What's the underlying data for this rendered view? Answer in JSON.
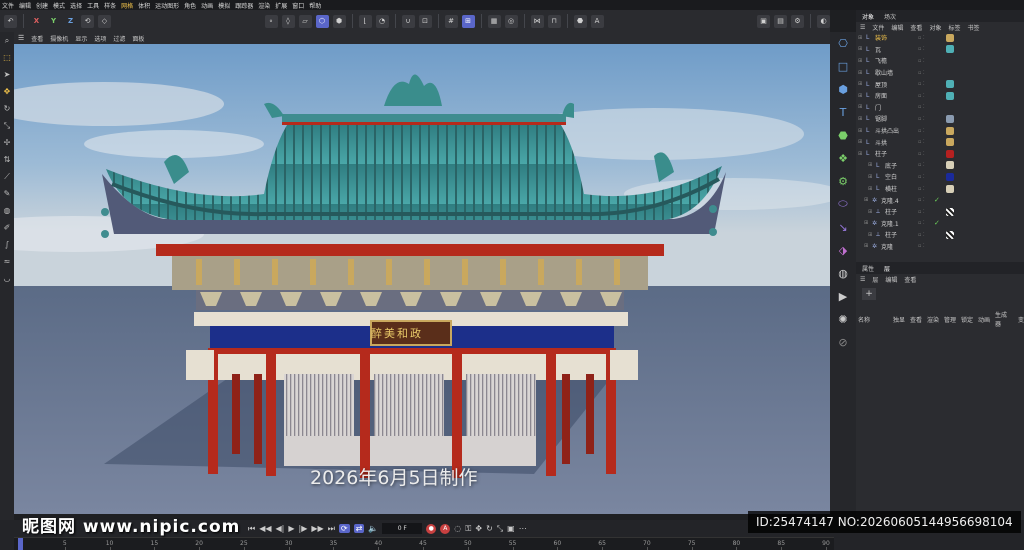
{
  "menubar": {
    "items": [
      "文件",
      "编辑",
      "创建",
      "模式",
      "选择",
      "工具",
      "样条",
      "网格",
      "体积",
      "运动图形",
      "角色",
      "动画",
      "模拟",
      "跟踪器",
      "渲染",
      "扩展",
      "窗口",
      "帮助"
    ]
  },
  "toolbar": {
    "x": "X",
    "y": "Y",
    "z": "Z"
  },
  "viewport_menu": [
    "查看",
    "摄像机",
    "显示",
    "选项",
    "过滤",
    "面板"
  ],
  "object_manager": {
    "tabs": [
      "对象",
      "场次"
    ],
    "menu": [
      "文件",
      "编辑",
      "查看",
      "对象",
      "标签",
      "书签"
    ],
    "objects": [
      {
        "name": "装饰",
        "selected": true,
        "color": "#c9a85e"
      },
      {
        "name": "瓦",
        "color": "#4fb0b5"
      },
      {
        "name": "飞檐",
        "color": ""
      },
      {
        "name": "歇山墙",
        "color": ""
      },
      {
        "name": "屋顶",
        "color": "#4fb0b5"
      },
      {
        "name": "房面",
        "color": "#4fb0b5"
      },
      {
        "name": "门",
        "color": ""
      },
      {
        "name": "锯脚",
        "color": "#8a9bb0"
      },
      {
        "name": "斗拱凸出",
        "color": "#c9a85e"
      },
      {
        "name": "斗拱",
        "color": "#c9a85e"
      },
      {
        "name": "柱子",
        "color": "#b52020"
      },
      {
        "name": "底子",
        "color": "#d8d0b8"
      },
      {
        "name": "空白",
        "color": "#1a2a9a"
      },
      {
        "name": "横柱",
        "color": "#d8d0b8"
      },
      {
        "name": "克隆.4",
        "check": "✓",
        "color": ""
      },
      {
        "name": "柱子",
        "color": "",
        "pattern": true
      },
      {
        "name": "克隆.1",
        "check": "✓",
        "color": ""
      },
      {
        "name": "柱子",
        "color": "",
        "pattern": true
      },
      {
        "name": "克隆",
        "color": ""
      }
    ]
  },
  "attributes": {
    "tabs": [
      "属性",
      "层"
    ],
    "menu": [
      "层",
      "编辑",
      "查看"
    ],
    "columns": [
      "名称",
      "独显",
      "查看",
      "渲染",
      "管理",
      "锁定",
      "动画",
      "生成器",
      "变"
    ]
  },
  "timeline": {
    "frame": "0 F",
    "ticks": [
      "0",
      "5",
      "10",
      "15",
      "20",
      "25",
      "30",
      "35",
      "40",
      "45",
      "50",
      "55",
      "60",
      "65",
      "70",
      "75",
      "80",
      "85",
      "90"
    ]
  },
  "scene": {
    "plaque": "醉美和政",
    "caption": "2026年6月5日制作"
  },
  "watermark": {
    "site": "昵图网 www.nipic.com",
    "id": "ID:25474147 NO:20260605144956698104"
  },
  "colors": {
    "accent": "#5a66c9",
    "selected_text": "#f2c34b",
    "roof_tile": "#3f8c8f",
    "pillar": "#b52a1c",
    "beam_blue": "#1c2f8a"
  }
}
